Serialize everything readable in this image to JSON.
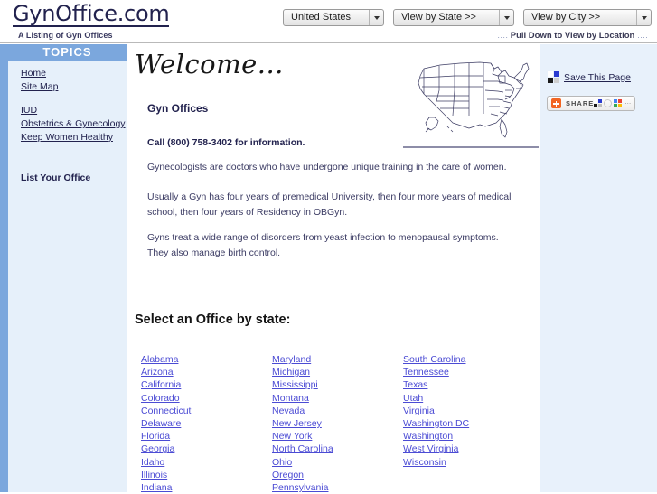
{
  "header": {
    "site_title": "GynOffice.com",
    "tagline": "A Listing of Gyn Offices",
    "dropdowns": [
      {
        "name": "country",
        "value": "United States"
      },
      {
        "name": "state",
        "value": "View by State >>"
      },
      {
        "name": "city",
        "value": "View by City >>"
      }
    ],
    "pulldown_hint": "Pull Down to View by Location"
  },
  "sidebar": {
    "heading": "TOPICS",
    "items": [
      {
        "label": "Home",
        "bold": false
      },
      {
        "label": "Site Map",
        "bold": false
      },
      {
        "label": "IUD",
        "bold": false
      },
      {
        "label": "Obstetrics & Gynecology",
        "bold": false
      },
      {
        "label": "Keep Women Healthy",
        "bold": false
      },
      {
        "label": "List Your Office",
        "bold": true
      }
    ]
  },
  "main": {
    "welcome_script": "Welcome...",
    "heading": "Gyn Offices",
    "call_line": "Call (800) 758-3402 for information.",
    "paragraphs": [
      "Gynecologists are doctors who have undergone unique training in the care of women.",
      "Usually a Gyn has four years of premedical University, then four more years of medical school, then four years of Residency in OBGyn.",
      "Gyns treat a wide range of disorders from yeast infection to menopausal symptoms. They also manage birth control."
    ],
    "select_heading": "Select an Office by state:",
    "state_columns": [
      [
        "Alabama",
        "Arizona",
        "California",
        "Colorado",
        "Connecticut",
        "Delaware",
        "Florida",
        "Georgia",
        "Idaho",
        "Illinois",
        "Indiana"
      ],
      [
        "Maryland",
        "Michigan",
        "Mississippi",
        "Montana",
        "Nevada",
        "New Jersey",
        "New York",
        "North Carolina",
        "Ohio",
        "Oregon",
        "Pennsylvania"
      ],
      [
        "South Carolina",
        "Tennessee",
        "Texas",
        "Utah",
        "Virginia",
        "Washington DC",
        "Washington",
        "West Virginia",
        "Wisconsin"
      ]
    ]
  },
  "right_column": {
    "save_label": "Save This Page",
    "share_label": "SHARE"
  },
  "colors": {
    "sidebar_bg": "#e6f0fa",
    "accent_blue": "#7ba7dd",
    "link_blue": "#4b4bd4",
    "text_navy": "#22224e",
    "right_bg": "#e8f1fb",
    "share_orange": "#f26522"
  }
}
